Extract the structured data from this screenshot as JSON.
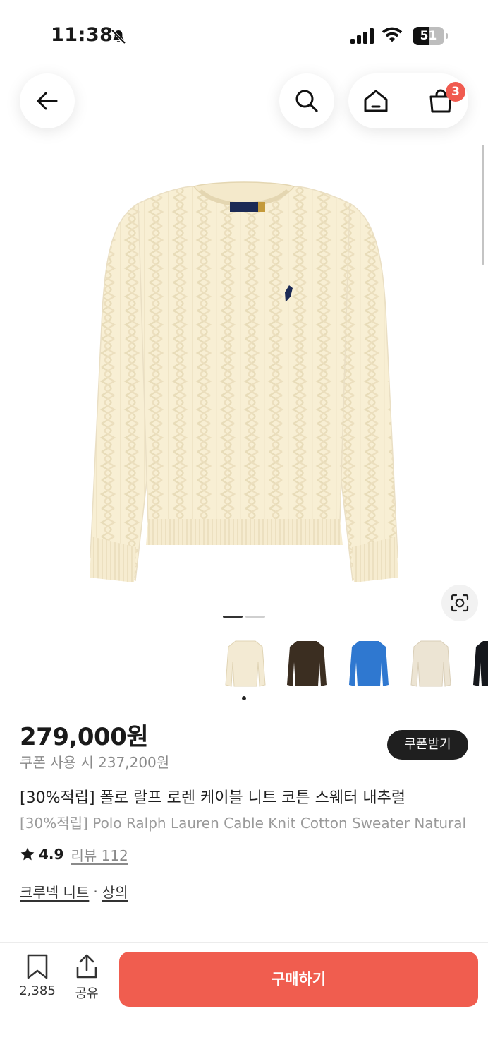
{
  "status_bar": {
    "time": "11:38",
    "battery_level": "51",
    "icons": [
      "bell-off-icon",
      "signal-icon",
      "wifi-icon",
      "battery-icon"
    ]
  },
  "nav": {
    "icons": [
      "back-arrow-icon",
      "search-icon",
      "home-icon",
      "cart-icon"
    ],
    "cart_badge": "3"
  },
  "product_image": {
    "description_icon": "cable-knit-sweater-image",
    "pager_active": 1,
    "pager_total": 2
  },
  "color_options": [
    {
      "name": "cream",
      "color": "#f3ead3"
    },
    {
      "name": "dark-brown",
      "color": "#3b2e21"
    },
    {
      "name": "blue",
      "color": "#2f78d0"
    },
    {
      "name": "ivory",
      "color": "#ece4d3"
    },
    {
      "name": "black",
      "color": "#15171c"
    }
  ],
  "product": {
    "price": "279,000원",
    "coupon_price": "쿠폰 사용 시 237,200원",
    "coupon_button": "쿠폰받기",
    "title_ko": "[30%적립] 폴로 랄프 로렌 케이블 니트 코튼 스웨터 내추럴",
    "title_en": "[30%적립] Polo Ralph Lauren Cable Knit Cotton Sweater Natural",
    "rating": "4.9",
    "review_label": "리뷰 112",
    "category_primary": "크루넥 니트",
    "category_separator": "·",
    "category_secondary": "상의"
  },
  "bottom_bar": {
    "bookmark_count": "2,385",
    "share_label": "공유",
    "buy_label": "구매하기"
  },
  "colors": {
    "accent": "#f05d4f",
    "badge": "#f05a4f",
    "dark_button": "#1f1f1f",
    "muted_text": "#8a8a8a"
  }
}
